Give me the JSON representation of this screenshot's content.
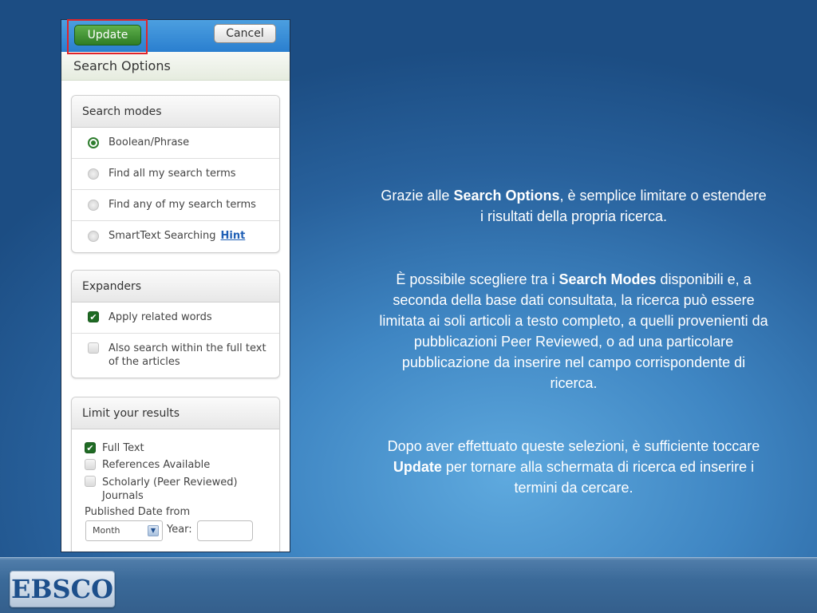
{
  "phone": {
    "update_label": "Update",
    "cancel_label": "Cancel",
    "title": "Search Options",
    "search_modes": {
      "heading": "Search modes",
      "options": [
        {
          "label": "Boolean/Phrase",
          "selected": true
        },
        {
          "label": "Find all my search terms",
          "selected": false
        },
        {
          "label": "Find any of my search terms",
          "selected": false
        },
        {
          "label": "SmartText Searching",
          "selected": false
        }
      ],
      "hint_label": "Hint"
    },
    "expanders": {
      "heading": "Expanders",
      "options": [
        {
          "label": "Apply related words",
          "checked": true
        },
        {
          "label": "Also search within the full text of the articles",
          "checked": false
        }
      ]
    },
    "limits": {
      "heading": "Limit your results",
      "full_text": "Full Text",
      "references": "References Available",
      "scholarly": "Scholarly (Peer Reviewed) Journals",
      "published_from": "Published Date from",
      "month_value": "Month",
      "year_label": "Year:"
    }
  },
  "text": {
    "p1_before": "Grazie alle ",
    "p1_bold": "Search Options",
    "p1_after": ", è semplice limitare o estendere i risultati della propria ricerca.",
    "p2_before": "È possibile scegliere tra i ",
    "p2_bold": "Search Modes",
    "p2_after": " disponibili e, a seconda della base dati consultata, la ricerca può essere limitata ai soli articoli a testo completo, a quelli provenienti da pubblicazioni Peer Reviewed, o ad una particolare pubblicazione da inserire nel campo corrispondente di ricerca.",
    "p3_before": "Dopo aver effettuato queste selezioni, è sufficiente toccare ",
    "p3_bold": "Update",
    "p3_after": " per tornare alla schermata di ricerca ed inserire i termini da cercare."
  },
  "logo": {
    "text": "EBSCO"
  },
  "colors": {
    "highlight": "#e0242a",
    "update_green": "#3f8f33",
    "check_green": "#1f6b24"
  }
}
